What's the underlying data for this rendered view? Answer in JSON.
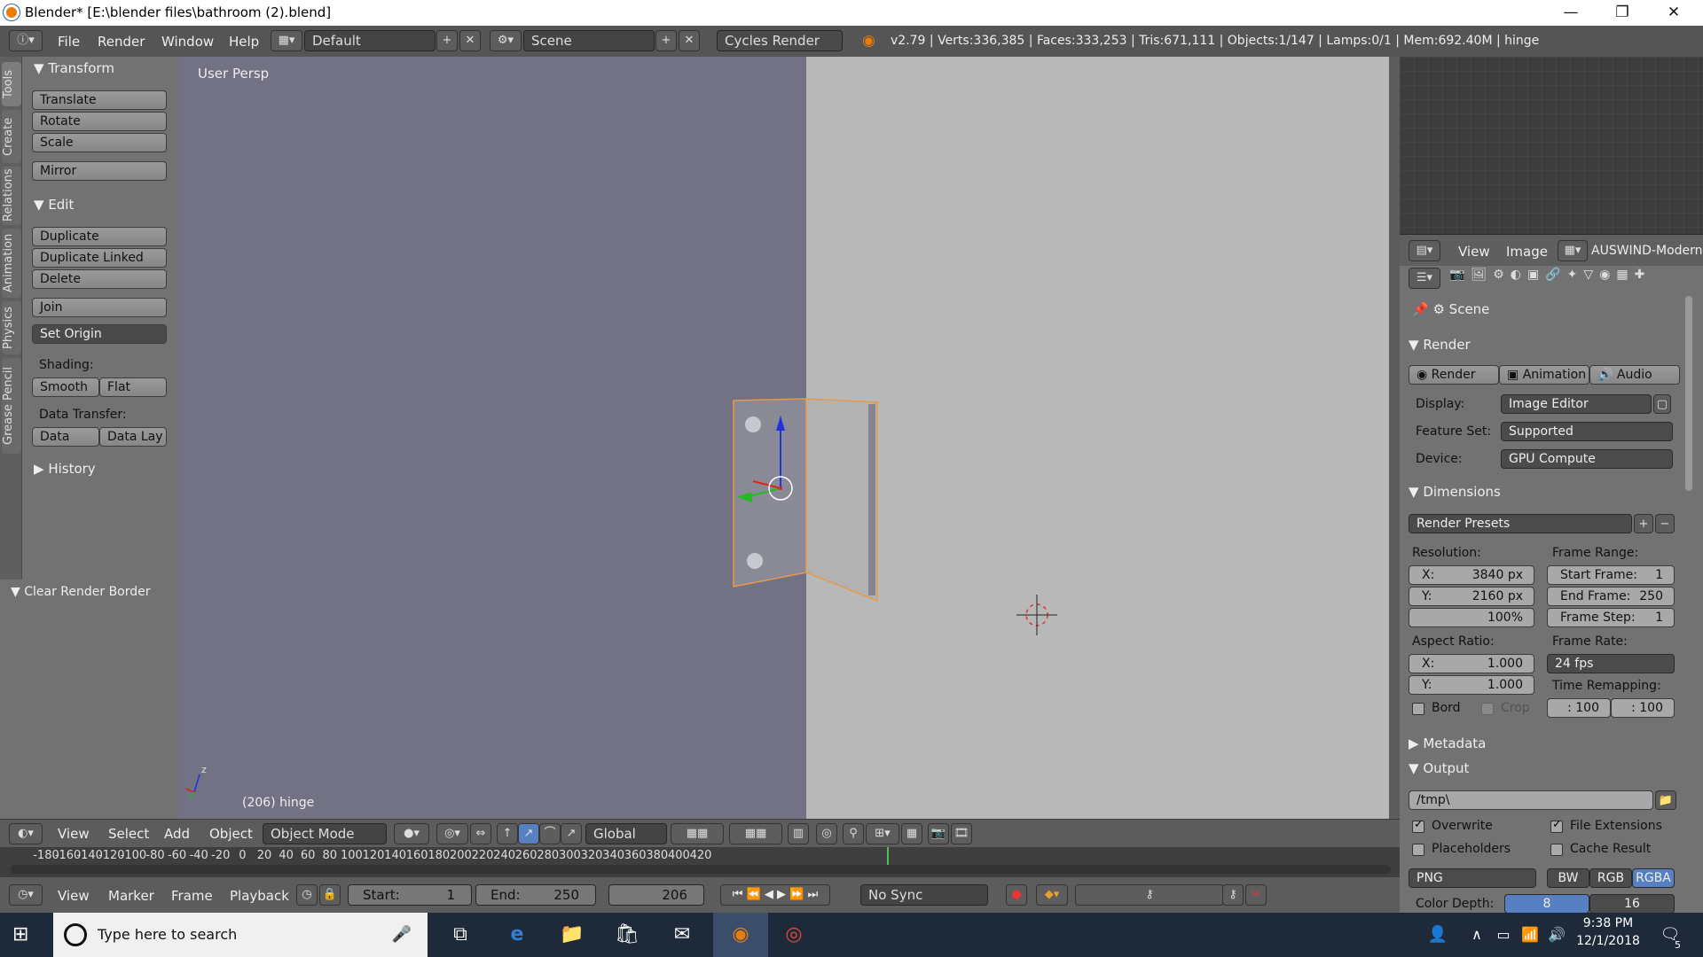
{
  "window": {
    "title": "Blender* [E:\\blender files\\bathroom (2).blend]"
  },
  "infobar": {
    "menus": [
      "File",
      "Render",
      "Window",
      "Help"
    ],
    "layout": "Default",
    "scene": "Scene",
    "engine": "Cycles Render",
    "stats": "v2.79 | Verts:336,385 | Faces:333,253 | Tris:671,111 | Objects:1/147 | Lamps:0/1 | Mem:692.40M | hinge"
  },
  "toolshelf": {
    "tabs": [
      "Tools",
      "Create",
      "Relations",
      "Animation",
      "Physics",
      "Grease Pencil"
    ],
    "transform_header": "Transform",
    "translate": "Translate",
    "rotate": "Rotate",
    "scale": "Scale",
    "mirror": "Mirror",
    "edit_header": "Edit",
    "duplicate": "Duplicate",
    "duplicate_linked": "Duplicate Linked",
    "delete": "Delete",
    "join": "Join",
    "set_origin": "Set Origin",
    "shading_label": "Shading:",
    "smooth": "Smooth",
    "flat": "Flat",
    "data_transfer_label": "Data Transfer:",
    "data": "Data",
    "data_lay": "Data Lay",
    "history_header": "History",
    "clear_render_border": "Clear Render Border"
  },
  "viewport": {
    "view_label": "User Persp",
    "object_label": "(206) hinge",
    "axis_z": "z"
  },
  "image_editor_header": {
    "view": "View",
    "image": "Image",
    "image_name": "AUSWIND-Modern"
  },
  "properties": {
    "context": "Scene",
    "render_header": "Render",
    "render_btn": "Render",
    "animation_btn": "Animation",
    "audio_btn": "Audio",
    "display_label": "Display:",
    "display_value": "Image Editor",
    "feature_set_label": "Feature Set:",
    "feature_set_value": "Supported",
    "device_label": "Device:",
    "device_value": "GPU Compute",
    "dimensions_header": "Dimensions",
    "render_presets": "Render Presets",
    "resolution_label": "Resolution:",
    "res_x": "X:",
    "res_x_val": "3840 px",
    "res_y": "Y:",
    "res_y_val": "2160 px",
    "res_pct": "100%",
    "frame_range_label": "Frame Range:",
    "start_frame": "Start Frame:",
    "start_frame_val": "1",
    "end_frame": "End Frame:",
    "end_frame_val": "250",
    "frame_step": "Frame Step:",
    "frame_step_val": "1",
    "aspect_label": "Aspect Ratio:",
    "asp_x": "X:",
    "asp_x_val": "1.000",
    "asp_y": "Y:",
    "asp_y_val": "1.000",
    "frame_rate_label": "Frame Rate:",
    "frame_rate_val": "24 fps",
    "time_remap_label": "Time Remapping:",
    "remap_old": ": 100",
    "remap_new": ": 100",
    "bord": "Bord",
    "crop": "Crop",
    "metadata_header": "Metadata",
    "output_header": "Output",
    "output_path": "/tmp\\",
    "overwrite": "Overwrite",
    "file_extensions": "File Extensions",
    "placeholders": "Placeholders",
    "cache_result": "Cache Result",
    "format": "PNG",
    "bw": "BW",
    "rgb": "RGB",
    "rgba": "RGBA",
    "color_depth_label": "Color Depth:",
    "depth_8": "8",
    "depth_16": "16"
  },
  "view_header": {
    "view": "View",
    "select": "Select",
    "add": "Add",
    "object": "Object",
    "mode": "Object Mode",
    "orientation": "Global"
  },
  "timeline_ticks": [
    "-180",
    "-160",
    "-140",
    "-120",
    "-100",
    "-80",
    "-60",
    "-40",
    "-20",
    "0",
    "20",
    "40",
    "60",
    "80",
    "100",
    "120",
    "140",
    "160",
    "180",
    "200",
    "220",
    "240",
    "260",
    "280",
    "300",
    "320",
    "340",
    "360",
    "380",
    "400",
    "420"
  ],
  "timeline_header": {
    "view": "View",
    "marker": "Marker",
    "frame": "Frame",
    "playback": "Playback",
    "start_label": "Start:",
    "start_val": "1",
    "end_label": "End:",
    "end_val": "250",
    "current": "206",
    "sync": "No Sync"
  },
  "taskbar": {
    "search_placeholder": "Type here to search",
    "time": "9:38 PM",
    "date": "12/1/2018",
    "notifications": "5"
  }
}
